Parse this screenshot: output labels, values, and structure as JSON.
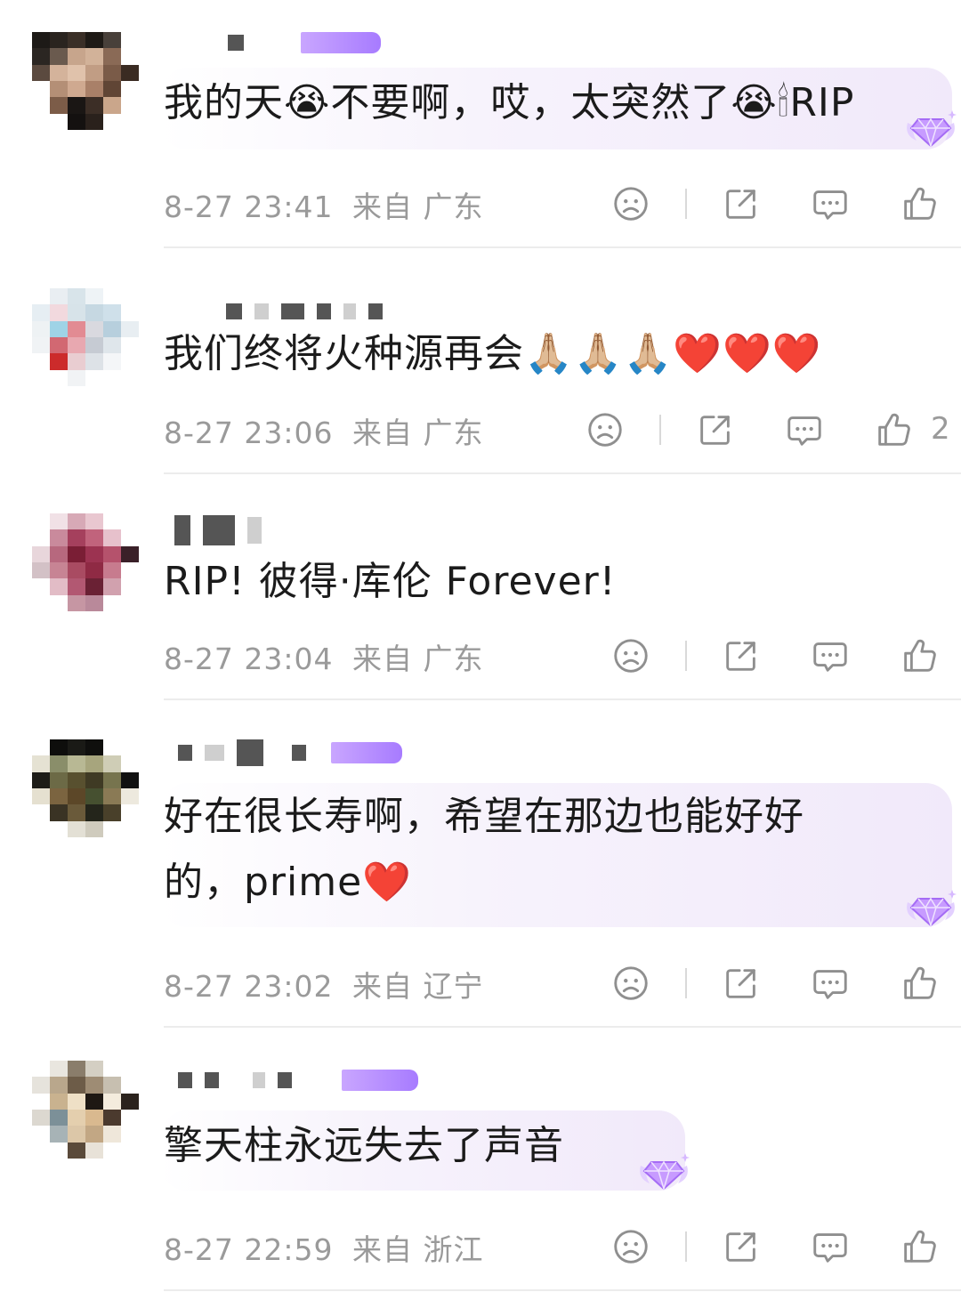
{
  "comments": [
    {
      "text": "我的天😭不要啊，哎，太突然了😭🕯RIP",
      "time": "8-27 23:41",
      "location": "来自 广东",
      "likes": "",
      "badge": "diamond-badge"
    },
    {
      "text": "我们终将火种源再会🙏🏼🙏🏼🙏🏼❤️❤️❤️",
      "time": "8-27 23:06",
      "location": "来自 广东",
      "likes": "2",
      "badge": ""
    },
    {
      "text": "RIP! 彼得·库伦 Forever!",
      "time": "8-27 23:04",
      "location": "来自 广东",
      "likes": "",
      "badge": ""
    },
    {
      "text_line1": "好在很长寿啊，希望在那边也能好好",
      "text_line2": "的，prime❤️",
      "time": "8-27 23:02",
      "location": "来自 辽宁",
      "likes": "",
      "badge": "diamond-badge"
    },
    {
      "text": "擎天柱永远失去了声音",
      "time": "8-27 22:59",
      "location": "来自 浙江",
      "likes": "",
      "badge": "diamond-badge"
    }
  ],
  "icons": {
    "dislike": "sad-face-icon",
    "share": "share-icon",
    "reply": "comment-icon",
    "like": "thumbs-up-icon"
  },
  "colors": {
    "text": "#1b1b1b",
    "meta": "#9a9a9a",
    "icon": "#8f8f8f",
    "divider": "#ececec",
    "badge": "#b27cff"
  }
}
